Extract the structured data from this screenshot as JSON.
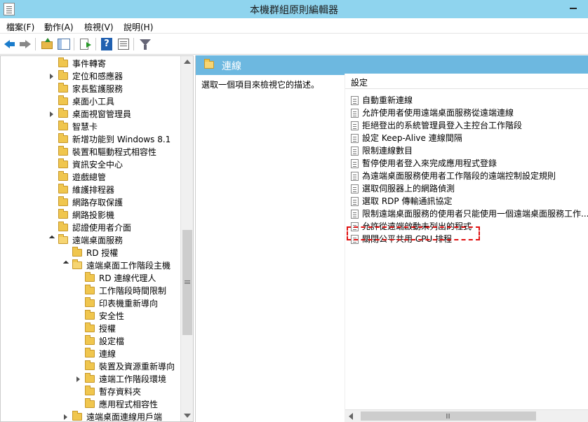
{
  "window": {
    "title": "本機群組原則編輯器"
  },
  "menu": [
    "檔案(F)",
    "動作(A)",
    "檢視(V)",
    "說明(H)"
  ],
  "toolbar": {
    "icons": [
      "back-icon",
      "forward-icon",
      "up-folder-icon",
      "show-hide-tree-icon",
      "export-list-icon",
      "help-icon",
      "properties-icon",
      "filter-icon"
    ]
  },
  "tree": {
    "items": [
      {
        "label": "事件轉寄",
        "level": 0,
        "expander": "none"
      },
      {
        "label": "定位和感應器",
        "level": 0,
        "expander": "collapsed"
      },
      {
        "label": "家長監護服務",
        "level": 0,
        "expander": "none"
      },
      {
        "label": "桌面小工具",
        "level": 0,
        "expander": "none"
      },
      {
        "label": "桌面視窗管理員",
        "level": 0,
        "expander": "collapsed"
      },
      {
        "label": "智慧卡",
        "level": 0,
        "expander": "none"
      },
      {
        "label": "新增功能到 Windows 8.1",
        "level": 0,
        "expander": "none"
      },
      {
        "label": "裝置和驅動程式相容性",
        "level": 0,
        "expander": "none"
      },
      {
        "label": "資訊安全中心",
        "level": 0,
        "expander": "none"
      },
      {
        "label": "遊戲總管",
        "level": 0,
        "expander": "none"
      },
      {
        "label": "維護排程器",
        "level": 0,
        "expander": "none"
      },
      {
        "label": "網路存取保護",
        "level": 0,
        "expander": "none"
      },
      {
        "label": "網路投影機",
        "level": 0,
        "expander": "none"
      },
      {
        "label": "認證使用者介面",
        "level": 0,
        "expander": "none"
      },
      {
        "label": "遠端桌面服務",
        "level": 0,
        "expander": "expanded"
      },
      {
        "label": "RD 授權",
        "level": 1,
        "expander": "none"
      },
      {
        "label": "遠端桌面工作階段主機",
        "level": 1,
        "expander": "expanded"
      },
      {
        "label": "RD 連線代理人",
        "level": 2,
        "expander": "none"
      },
      {
        "label": "工作階段時間限制",
        "level": 2,
        "expander": "none"
      },
      {
        "label": "印表機重新導向",
        "level": 2,
        "expander": "none"
      },
      {
        "label": "安全性",
        "level": 2,
        "expander": "none"
      },
      {
        "label": "授權",
        "level": 2,
        "expander": "none"
      },
      {
        "label": "設定檔",
        "level": 2,
        "expander": "none"
      },
      {
        "label": "連線",
        "level": 2,
        "expander": "none"
      },
      {
        "label": "裝置及資源重新導向",
        "level": 2,
        "expander": "none"
      },
      {
        "label": "遠端工作階段環境",
        "level": 2,
        "expander": "collapsed"
      },
      {
        "label": "暫存資料夾",
        "level": 2,
        "expander": "none"
      },
      {
        "label": "應用程式相容性",
        "level": 2,
        "expander": "none"
      },
      {
        "label": "遠端桌面連線用戶端",
        "level": 1,
        "expander": "collapsed"
      }
    ]
  },
  "right": {
    "header_title": "連線",
    "description": "選取一個項目來檢視它的描述。",
    "column_header": "設定",
    "rows": [
      "自動重新連線",
      "允許使用者使用遠端桌面服務從遠端連線",
      "拒絕登出的系統管理員登入主控台工作階段",
      "設定 Keep-Alive 連線間隔",
      "限制連線數目",
      "暫停使用者登入來完成應用程式登錄",
      "為遠端桌面服務使用者工作階段的遠端控制設定規則",
      "選取伺服器上的網路偵測",
      "選取 RDP 傳輸通訊協定",
      "限制遠端桌面服務的使用者只能使用一個遠端桌面服務工作...",
      "允許從遠端啟動未列出的程式",
      "關閉公平共用 CPU 排程"
    ],
    "highlighted_row": 10
  },
  "colors": {
    "titlebar": "#8fd4ee",
    "header": "#6db8e0",
    "highlight_border": "#e01010"
  }
}
